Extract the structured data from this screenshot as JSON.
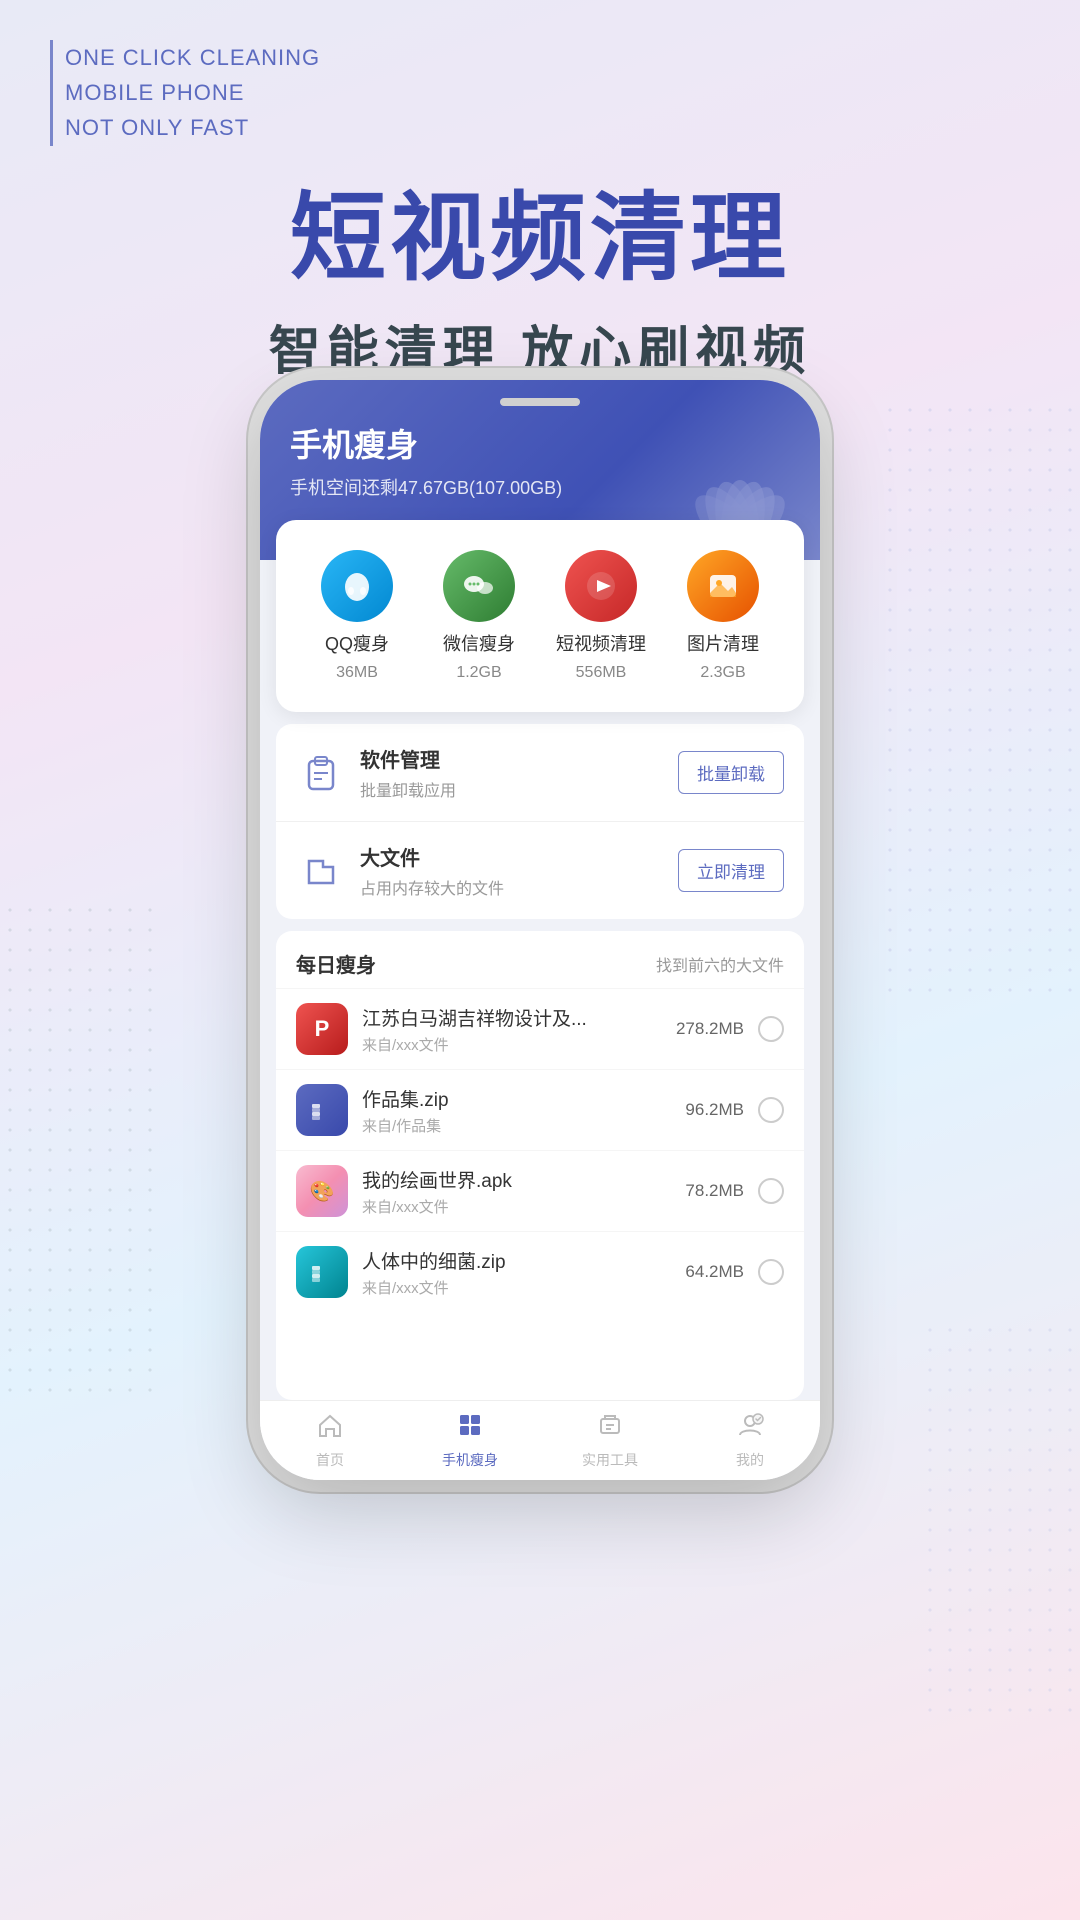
{
  "tagline": {
    "line1": "ONE CLICK CLEANING",
    "line2": "MOBILE PHONE",
    "line3": "NOT ONLY FAST"
  },
  "hero": {
    "main_text": "短视频清理",
    "sub_text": "智能清理  放心刷视频"
  },
  "app_header": {
    "title": "手机瘦身",
    "subtitle": "手机空间还剩47.67GB(107.00GB)"
  },
  "app_icons": [
    {
      "id": "qq",
      "icon": "🐧",
      "name": "QQ瘦身",
      "size": "36MB",
      "icon_class": "icon-qq"
    },
    {
      "id": "wechat",
      "icon": "💬",
      "name": "微信瘦身",
      "size": "1.2GB",
      "icon_class": "icon-wechat"
    },
    {
      "id": "video",
      "icon": "▶",
      "name": "短视频清理",
      "size": "556MB",
      "icon_class": "icon-video"
    },
    {
      "id": "photo",
      "icon": "🖼",
      "name": "图片清理",
      "size": "2.3GB",
      "icon_class": "icon-photo"
    }
  ],
  "list_items": [
    {
      "id": "software",
      "icon": "📦",
      "title": "软件管理",
      "desc": "批量卸载应用",
      "btn": "批量卸载"
    },
    {
      "id": "bigfile",
      "icon": "📁",
      "title": "大文件",
      "desc": "占用内存较大的文件",
      "btn": "立即清理"
    }
  ],
  "daily": {
    "title": "每日瘦身",
    "hint": "找到前六的大文件",
    "items": [
      {
        "id": "jiangsu",
        "icon_type": "p",
        "name": "江苏白马湖吉祥物设计及...",
        "from": "来自/xxx文件",
        "size": "278.2MB"
      },
      {
        "id": "works",
        "icon_type": "zip-blue",
        "name": "作品集.zip",
        "from": "来自/作品集",
        "size": "96.2MB"
      },
      {
        "id": "drawing",
        "icon_type": "apk",
        "name": "我的绘画世界.apk",
        "from": "来自/xxx文件",
        "size": "78.2MB"
      },
      {
        "id": "bacteria",
        "icon_type": "zip-green",
        "name": "人体中的细菌.zip",
        "from": "来自/xxx文件",
        "size": "64.2MB"
      }
    ]
  },
  "bottom_nav": [
    {
      "id": "home",
      "icon": "⌂",
      "label": "首页",
      "active": false
    },
    {
      "id": "slim",
      "icon": "⚙",
      "label": "手机瘦身",
      "active": true
    },
    {
      "id": "tools",
      "icon": "🧹",
      "label": "实用工具",
      "active": false
    },
    {
      "id": "mine",
      "icon": "👤",
      "label": "我的",
      "active": false
    }
  ]
}
